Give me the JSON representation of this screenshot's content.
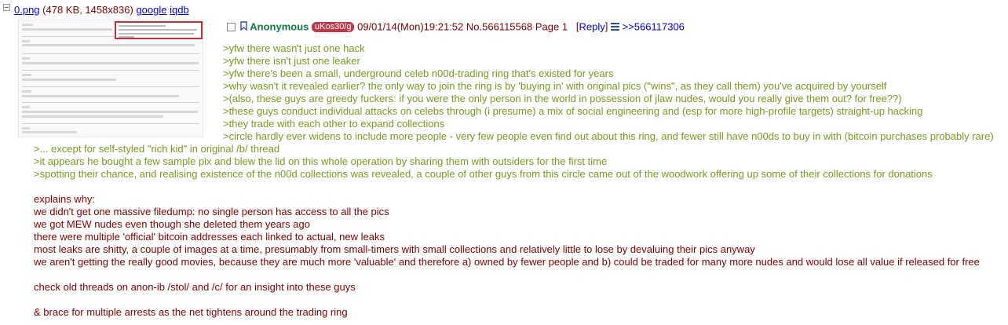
{
  "file": {
    "name": "0.png",
    "meta": "(478 KB, 1458x836)",
    "links": [
      "google",
      "iqdb"
    ]
  },
  "post": {
    "name": "Anonymous",
    "id": "uKos30/g",
    "datetime": "09/01/14(Mon)19:21:52",
    "number": "No.566115568",
    "page": "Page 1",
    "reply_label": "Reply",
    "backlink": ">>566117306",
    "body": [
      {
        "text": ">yfw there wasn't just one hack",
        "kind": "greentext"
      },
      {
        "text": ">yfw there isn't just one leaker",
        "kind": "greentext"
      },
      {
        "text": ">yfw there's been a small, underground celeb n00d-trading ring that's existed for years",
        "kind": "greentext"
      },
      {
        "text": ">why wasn't it revealed earlier? the only way to join the ring is by 'buying in' with original pics (\"wins\", as they call them) you've acquired by yourself",
        "kind": "greentext"
      },
      {
        "text": ">(also, these guys are greedy fuckers: if you were the only person in the world in possession of jlaw nudes, would you really give them out? for free??)",
        "kind": "greentext"
      },
      {
        "text": ">these guys conduct individual attacks on celebs through (i presume) a mix of social engineering and (esp for more high-profile targets) straight-up hacking",
        "kind": "greentext"
      },
      {
        "text": ">they trade with each other to expand collections",
        "kind": "greentext"
      },
      {
        "text": ">circle hardly ever widens to include more people - very few people even find out about this ring, and fewer still have n00ds to buy in with (bitcoin purchases probably rare)",
        "kind": "greentext"
      },
      {
        "text": ">... except for self-styled \"rich kid\" in original /b/ thread",
        "kind": "greentext"
      },
      {
        "text": ">it appears he bought a few sample pix and blew the lid on this whole operation by sharing them with outsiders for the first time",
        "kind": "greentext"
      },
      {
        "text": ">spotting their chance, and realising existence of the n00d collections was revealed, a couple of other guys from this circle came out of the woodwork offering up some of their collections for donations",
        "kind": "greentext"
      },
      {
        "text": "explains why:",
        "kind": "plain"
      },
      {
        "text": "we didn't get one massive filedump: no single person has access to all the pics",
        "kind": "plain"
      },
      {
        "text": "we got MEW nudes even though she deleted them years ago",
        "kind": "plain"
      },
      {
        "text": "there were multiple 'official' bitcoin addresses each linked to actual, new leaks",
        "kind": "plain"
      },
      {
        "text": "most leaks are shitty, a couple of images at a time, presumably from small-timers with small collections and relatively little to lose by devaluing their pics anyway",
        "kind": "plain"
      },
      {
        "text": "we aren't getting the really good movies, because they are much more 'valuable' and therefore a) owned by fewer people and b) could be traded for many more nudes and would lose all value if released for free",
        "kind": "plain"
      },
      {
        "text": "check old threads on anon-ib /stol/ and /c/ for an insight into these guys",
        "kind": "plain"
      },
      {
        "text": "& brace for multiple arrests as the net tightens around the trading ring",
        "kind": "plain"
      }
    ]
  },
  "colors": {
    "text": "#800000",
    "greentext": "#789922",
    "name": "#117743",
    "link": "#0000ee",
    "id_badge": "#c0394b"
  }
}
